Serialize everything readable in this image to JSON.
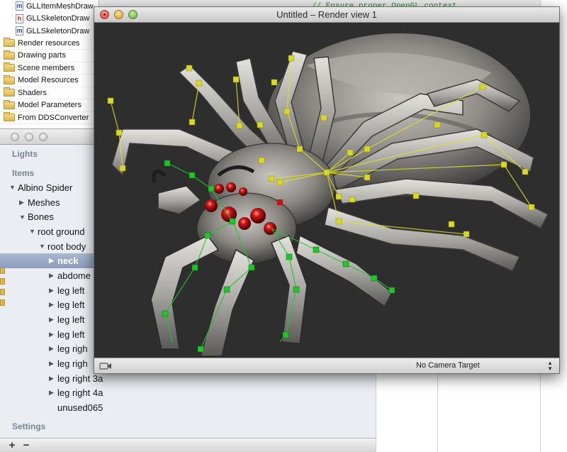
{
  "navigator": {
    "files": [
      {
        "badge": "m",
        "name": "GLLItemMeshDraw"
      },
      {
        "badge": "h",
        "name": "GLLSkeletonDraw"
      },
      {
        "badge": "m",
        "name": "GLLSkeletonDraw"
      }
    ],
    "groups": [
      {
        "name": "Render resources"
      },
      {
        "name": "Drawing parts"
      },
      {
        "name": "Scene members"
      },
      {
        "name": "Model Resources"
      },
      {
        "name": "Shaders"
      },
      {
        "name": "Model Parameters"
      },
      {
        "name": "From DDSConverter"
      }
    ]
  },
  "code_editor": {
    "top_comment": "// Ensure proper OpenGL context"
  },
  "render_window": {
    "title": "Untitled – Render view 1",
    "camera_target": "No Camera Target",
    "colors": {
      "background": "#2e2e2e",
      "selected_bones": "#e0df28",
      "other_bones": "#22c42a",
      "eyes": "#c01010"
    }
  },
  "inspector": {
    "lights_label": "Lights",
    "items_label": "Items",
    "settings_label": "Settings",
    "add_label": "+",
    "remove_label": "−",
    "tree": [
      {
        "label": "Albino Spider",
        "level": 0,
        "toggle": "expanded",
        "selected": false
      },
      {
        "label": "Meshes",
        "level": 1,
        "toggle": "collapsed",
        "selected": false
      },
      {
        "label": "Bones",
        "level": 1,
        "toggle": "expanded",
        "selected": false
      },
      {
        "label": "root ground",
        "level": 2,
        "toggle": "expanded",
        "selected": false
      },
      {
        "label": "root body",
        "level": 3,
        "toggle": "expanded",
        "selected": false
      },
      {
        "label": "neck",
        "level": 4,
        "toggle": "collapsed",
        "selected": true
      },
      {
        "label": "abdome",
        "level": 4,
        "toggle": "collapsed",
        "selected": false
      },
      {
        "label": "leg left",
        "level": 4,
        "toggle": "collapsed",
        "selected": false
      },
      {
        "label": "leg left",
        "level": 4,
        "toggle": "collapsed",
        "selected": false
      },
      {
        "label": "leg left",
        "level": 4,
        "toggle": "collapsed",
        "selected": false
      },
      {
        "label": "leg left",
        "level": 4,
        "toggle": "collapsed",
        "selected": false
      },
      {
        "label": "leg righ",
        "level": 4,
        "toggle": "collapsed",
        "selected": false
      },
      {
        "label": "leg righ",
        "level": 4,
        "toggle": "collapsed",
        "selected": false
      },
      {
        "label": "leg right 3a",
        "level": 4,
        "toggle": "collapsed",
        "selected": false
      },
      {
        "label": "leg right 4a",
        "level": 4,
        "toggle": "collapsed",
        "selected": false
      },
      {
        "label": "unused065",
        "level": 4,
        "toggle": "none",
        "selected": false
      }
    ]
  }
}
